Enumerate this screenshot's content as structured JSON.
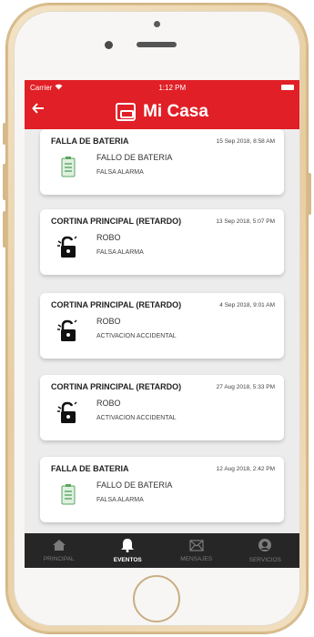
{
  "status": {
    "carrier": "Carrier",
    "time": "1:12 PM"
  },
  "header": {
    "title": "Mi Casa"
  },
  "events": [
    {
      "title": "FALLA DE BATERIA",
      "date": "15 Sep 2018, 8:58 AM",
      "event": "FALLO DE BATERIA",
      "status": "FALSA ALARMA",
      "icon": "battery-list-icon"
    },
    {
      "title": "CORTINA PRINCIPAL (RETARDO)",
      "date": "13 Sep 2018, 5:07 PM",
      "event": "ROBO",
      "status": "FALSA ALARMA",
      "icon": "broken-lock-icon"
    },
    {
      "title": "CORTINA PRINCIPAL (RETARDO)",
      "date": "4 Sep 2018, 9:01 AM",
      "event": "ROBO",
      "status": "ACTIVACION ACCIDENTAL",
      "icon": "broken-lock-icon"
    },
    {
      "title": "CORTINA PRINCIPAL (RETARDO)",
      "date": "27 Aug 2018, 5:33 PM",
      "event": "ROBO",
      "status": "ACTIVACION ACCIDENTAL",
      "icon": "broken-lock-icon"
    },
    {
      "title": "FALLA DE BATERIA",
      "date": "12 Aug 2018, 2:42 PM",
      "event": "FALLO DE BATERIA",
      "status": "FALSA ALARMA",
      "icon": "battery-list-icon"
    }
  ],
  "tabs": [
    {
      "label": "PRINCIPAL",
      "icon": "home-icon",
      "active": false
    },
    {
      "label": "EVENTOS",
      "icon": "bell-icon",
      "active": true
    },
    {
      "label": "MENSAJES",
      "icon": "envelope-icon",
      "active": false
    },
    {
      "label": "SERVICIOS",
      "icon": "support-icon",
      "active": false
    }
  ],
  "colors": {
    "accent": "#e01f26",
    "tabbar": "#262626"
  }
}
